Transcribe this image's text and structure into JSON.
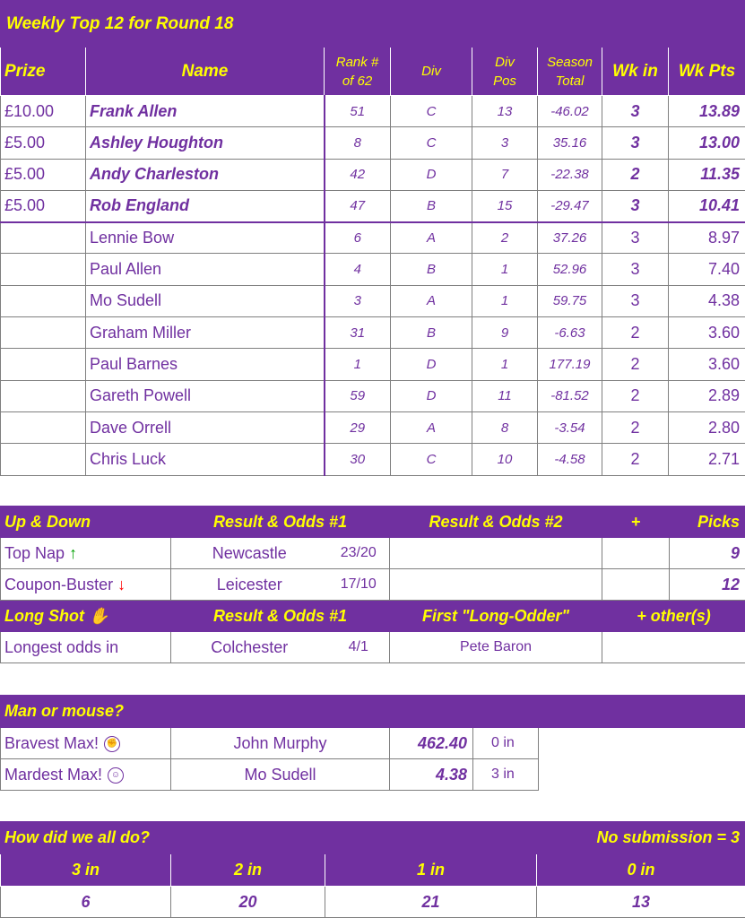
{
  "weekly": {
    "title": "Weekly Top 12 for Round 18",
    "headers": {
      "prize": "Prize",
      "name": "Name",
      "rank_line1": "Rank #",
      "rank_line2": "of 62",
      "div": "Div",
      "divpos_line1": "Div",
      "divpos_line2": "Pos",
      "season_line1": "Season",
      "season_line2": "Total",
      "wkin": "Wk in",
      "wkpts": "Wk Pts"
    },
    "rows": [
      {
        "prize": "£10.00",
        "name": "Frank Allen",
        "rank": "51",
        "div": "C",
        "divpos": "13",
        "season": "-46.02",
        "wkin": "3",
        "wkpts": "13.89"
      },
      {
        "prize": "£5.00",
        "name": "Ashley Houghton",
        "rank": "8",
        "div": "C",
        "divpos": "3",
        "season": "35.16",
        "wkin": "3",
        "wkpts": "13.00"
      },
      {
        "prize": "£5.00",
        "name": "Andy Charleston",
        "rank": "42",
        "div": "D",
        "divpos": "7",
        "season": "-22.38",
        "wkin": "2",
        "wkpts": "11.35"
      },
      {
        "prize": "£5.00",
        "name": "Rob England",
        "rank": "47",
        "div": "B",
        "divpos": "15",
        "season": "-29.47",
        "wkin": "3",
        "wkpts": "10.41"
      },
      {
        "prize": "",
        "name": "Lennie Bow",
        "rank": "6",
        "div": "A",
        "divpos": "2",
        "season": "37.26",
        "wkin": "3",
        "wkpts": "8.97"
      },
      {
        "prize": "",
        "name": "Paul Allen",
        "rank": "4",
        "div": "B",
        "divpos": "1",
        "season": "52.96",
        "wkin": "3",
        "wkpts": "7.40"
      },
      {
        "prize": "",
        "name": "Mo Sudell",
        "rank": "3",
        "div": "A",
        "divpos": "1",
        "season": "59.75",
        "wkin": "3",
        "wkpts": "4.38"
      },
      {
        "prize": "",
        "name": "Graham Miller",
        "rank": "31",
        "div": "B",
        "divpos": "9",
        "season": "-6.63",
        "wkin": "2",
        "wkpts": "3.60"
      },
      {
        "prize": "",
        "name": "Paul Barnes",
        "rank": "1",
        "div": "D",
        "divpos": "1",
        "season": "177.19",
        "wkin": "2",
        "wkpts": "3.60"
      },
      {
        "prize": "",
        "name": "Gareth Powell",
        "rank": "59",
        "div": "D",
        "divpos": "11",
        "season": "-81.52",
        "wkin": "2",
        "wkpts": "2.89"
      },
      {
        "prize": "",
        "name": "Dave Orrell",
        "rank": "29",
        "div": "A",
        "divpos": "8",
        "season": "-3.54",
        "wkin": "2",
        "wkpts": "2.80"
      },
      {
        "prize": "",
        "name": "Chris Luck",
        "rank": "30",
        "div": "C",
        "divpos": "10",
        "season": "-4.58",
        "wkin": "2",
        "wkpts": "2.71"
      }
    ]
  },
  "updown": {
    "header": {
      "label": "Up & Down",
      "res1": "Result & Odds #1",
      "res2": "Result & Odds #2",
      "plus": "+",
      "picks": "Picks"
    },
    "top_nap": {
      "label": "Top Nap",
      "arrow": "↑",
      "team": "Newcastle",
      "odds": "23/20",
      "picks": "9"
    },
    "coupon": {
      "label": "Coupon-Buster",
      "arrow": "↓",
      "team": "Leicester",
      "odds": "17/10",
      "picks": "12"
    },
    "longshot_header": {
      "label": "Long Shot",
      "icon": "✋",
      "res1": "Result & Odds #1",
      "first": "First \"Long-Odder\"",
      "other": "+ other(s)"
    },
    "longest": {
      "label": "Longest odds in",
      "team": "Colchester",
      "odds": "4/1",
      "person": "Pete Baron"
    }
  },
  "manmouse": {
    "header": "Man or mouse?",
    "bravest": {
      "label": "Bravest Max!",
      "icon": "fist-icon",
      "name": "John Murphy",
      "pts": "462.40",
      "in": "0 in"
    },
    "mardest": {
      "label": "Mardest Max!",
      "icon": "baby-face-icon",
      "name": "Mo Sudell",
      "pts": "4.38",
      "in": "3 in"
    }
  },
  "summary": {
    "header": "How did we all do?",
    "nosub": "No submission = 3",
    "cols": [
      "3 in",
      "2 in",
      "1 in",
      "0 in"
    ],
    "vals": [
      "6",
      "20",
      "21",
      "13"
    ]
  },
  "colors": {
    "purple": "#7030A0",
    "yellow": "#FFFF00",
    "green": "#00A000",
    "red": "#FF0000"
  }
}
